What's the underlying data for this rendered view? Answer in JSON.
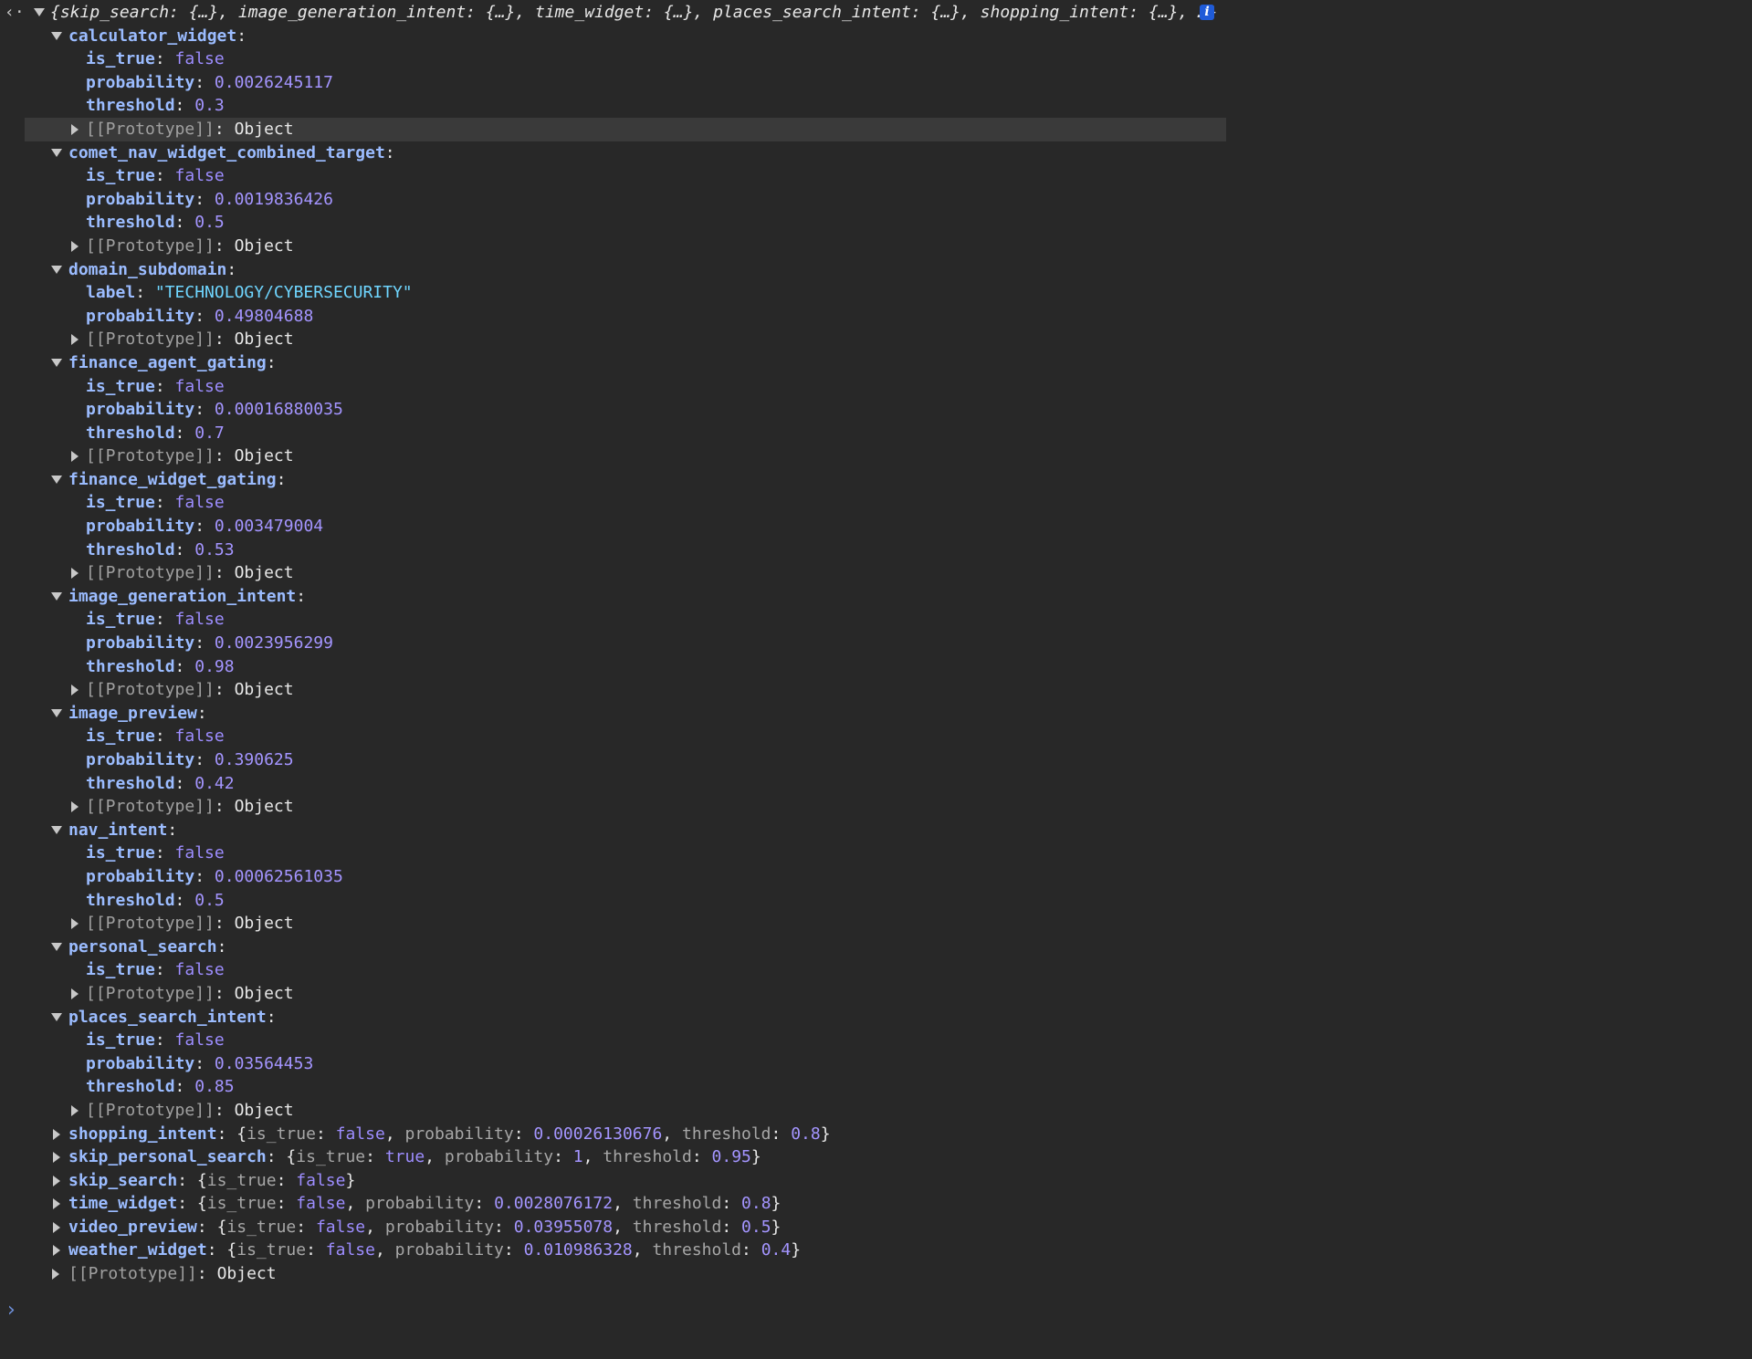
{
  "console": {
    "summary": "{skip_search: {…}, image_generation_intent: {…}, time_widget: {…}, places_search_intent: {…}, shopping_intent: {…}, …}",
    "info_icon_label": "i",
    "prompt_glyph": "›",
    "back_glyph": "‹·",
    "prototype_label": "[[Prototype]]",
    "prototype_value": "Object"
  },
  "expanded": [
    {
      "key": "calculator_widget",
      "props": [
        {
          "k": "is_true",
          "v": "false",
          "t": "bool"
        },
        {
          "k": "probability",
          "v": "0.0026245117",
          "t": "num"
        },
        {
          "k": "threshold",
          "v": "0.3",
          "t": "num"
        }
      ],
      "highlight_proto": true
    },
    {
      "key": "comet_nav_widget_combined_target",
      "props": [
        {
          "k": "is_true",
          "v": "false",
          "t": "bool"
        },
        {
          "k": "probability",
          "v": "0.0019836426",
          "t": "num"
        },
        {
          "k": "threshold",
          "v": "0.5",
          "t": "num"
        }
      ]
    },
    {
      "key": "domain_subdomain",
      "props": [
        {
          "k": "label",
          "v": "\"TECHNOLOGY/CYBERSECURITY\"",
          "t": "str"
        },
        {
          "k": "probability",
          "v": "0.49804688",
          "t": "num"
        }
      ]
    },
    {
      "key": "finance_agent_gating",
      "props": [
        {
          "k": "is_true",
          "v": "false",
          "t": "bool"
        },
        {
          "k": "probability",
          "v": "0.00016880035",
          "t": "num"
        },
        {
          "k": "threshold",
          "v": "0.7",
          "t": "num"
        }
      ]
    },
    {
      "key": "finance_widget_gating",
      "props": [
        {
          "k": "is_true",
          "v": "false",
          "t": "bool"
        },
        {
          "k": "probability",
          "v": "0.003479004",
          "t": "num"
        },
        {
          "k": "threshold",
          "v": "0.53",
          "t": "num"
        }
      ]
    },
    {
      "key": "image_generation_intent",
      "props": [
        {
          "k": "is_true",
          "v": "false",
          "t": "bool"
        },
        {
          "k": "probability",
          "v": "0.0023956299",
          "t": "num"
        },
        {
          "k": "threshold",
          "v": "0.98",
          "t": "num"
        }
      ]
    },
    {
      "key": "image_preview",
      "props": [
        {
          "k": "is_true",
          "v": "false",
          "t": "bool"
        },
        {
          "k": "probability",
          "v": "0.390625",
          "t": "num"
        },
        {
          "k": "threshold",
          "v": "0.42",
          "t": "num"
        }
      ]
    },
    {
      "key": "nav_intent",
      "props": [
        {
          "k": "is_true",
          "v": "false",
          "t": "bool"
        },
        {
          "k": "probability",
          "v": "0.00062561035",
          "t": "num"
        },
        {
          "k": "threshold",
          "v": "0.5",
          "t": "num"
        }
      ]
    },
    {
      "key": "personal_search",
      "props": [
        {
          "k": "is_true",
          "v": "false",
          "t": "bool"
        }
      ]
    },
    {
      "key": "places_search_intent",
      "props": [
        {
          "k": "is_true",
          "v": "false",
          "t": "bool"
        },
        {
          "k": "probability",
          "v": "0.03564453",
          "t": "num"
        },
        {
          "k": "threshold",
          "v": "0.85",
          "t": "num"
        }
      ]
    }
  ],
  "collapsed": [
    {
      "key": "shopping_intent",
      "props": [
        {
          "k": "is_true",
          "v": "false",
          "t": "bool"
        },
        {
          "k": "probability",
          "v": "0.00026130676",
          "t": "num"
        },
        {
          "k": "threshold",
          "v": "0.8",
          "t": "num"
        }
      ]
    },
    {
      "key": "skip_personal_search",
      "props": [
        {
          "k": "is_true",
          "v": "true",
          "t": "bool"
        },
        {
          "k": "probability",
          "v": "1",
          "t": "num"
        },
        {
          "k": "threshold",
          "v": "0.95",
          "t": "num"
        }
      ]
    },
    {
      "key": "skip_search",
      "props": [
        {
          "k": "is_true",
          "v": "false",
          "t": "bool"
        }
      ]
    },
    {
      "key": "time_widget",
      "props": [
        {
          "k": "is_true",
          "v": "false",
          "t": "bool"
        },
        {
          "k": "probability",
          "v": "0.0028076172",
          "t": "num"
        },
        {
          "k": "threshold",
          "v": "0.8",
          "t": "num"
        }
      ]
    },
    {
      "key": "video_preview",
      "props": [
        {
          "k": "is_true",
          "v": "false",
          "t": "bool"
        },
        {
          "k": "probability",
          "v": "0.03955078",
          "t": "num"
        },
        {
          "k": "threshold",
          "v": "0.5",
          "t": "num"
        }
      ]
    },
    {
      "key": "weather_widget",
      "props": [
        {
          "k": "is_true",
          "v": "false",
          "t": "bool"
        },
        {
          "k": "probability",
          "v": "0.010986328",
          "t": "num"
        },
        {
          "k": "threshold",
          "v": "0.4",
          "t": "num"
        }
      ]
    }
  ]
}
